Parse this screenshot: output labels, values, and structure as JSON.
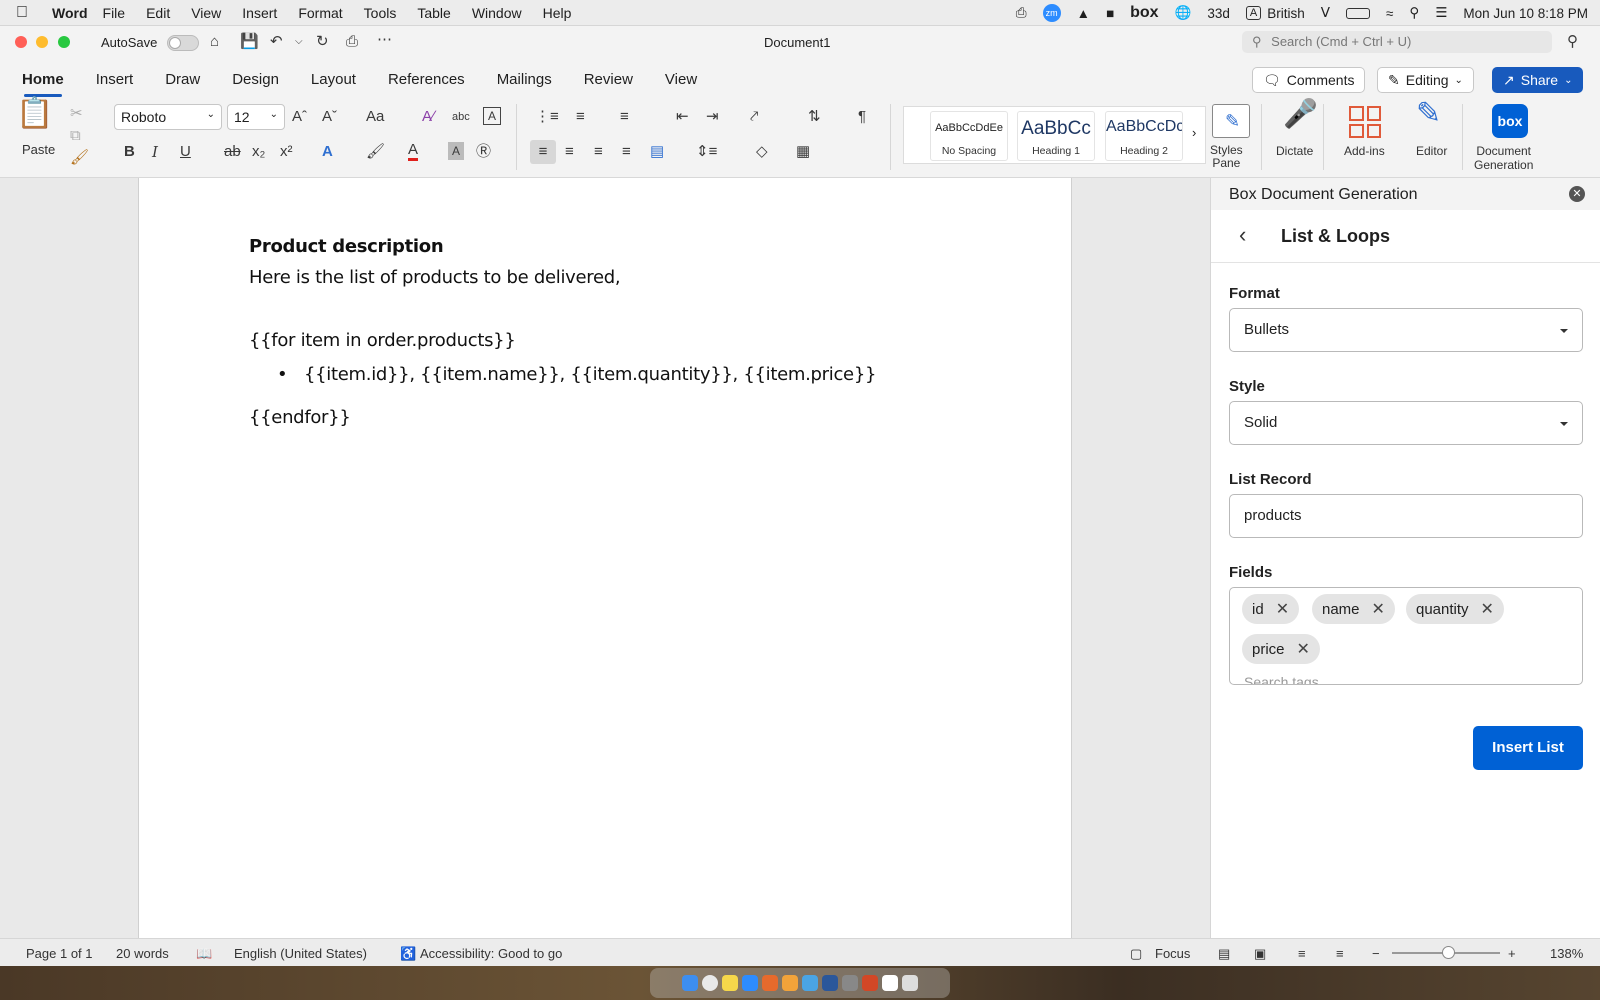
{
  "menubar": {
    "app": "Word",
    "items": [
      "File",
      "Edit",
      "View",
      "Insert",
      "Format",
      "Tools",
      "Table",
      "Window",
      "Help"
    ],
    "status": {
      "battery_text": "33d",
      "input_source": "British",
      "datetime": "Mon Jun 10  8:18 PM",
      "box_label": "box"
    }
  },
  "window": {
    "autosave_label": "AutoSave",
    "title": "Document1",
    "search_placeholder": "Search (Cmd + Ctrl + U)"
  },
  "tabs": [
    "Home",
    "Insert",
    "Draw",
    "Design",
    "Layout",
    "References",
    "Mailings",
    "Review",
    "View"
  ],
  "active_tab": "Home",
  "actions": {
    "comments": "Comments",
    "editing": "Editing",
    "share": "Share"
  },
  "ribbon": {
    "paste_label": "Paste",
    "font_name": "Roboto",
    "font_size": "12",
    "styles": [
      {
        "sample": "AaBbCcDdEe",
        "caption": "No Spacing"
      },
      {
        "sample": "AaBbCc",
        "caption": "Heading 1"
      },
      {
        "sample": "AaBbCcDc",
        "caption": "Heading 2"
      }
    ],
    "styles_pane": [
      "Styles",
      "Pane"
    ],
    "dictate": "Dictate",
    "addins": "Add-ins",
    "editor": "Editor",
    "docgen": [
      "Document",
      "Generation"
    ],
    "docgen_logo": "box"
  },
  "document": {
    "heading": "Product description",
    "intro": "Here is the list of products to be delivered,",
    "loop_start": "{{for item in order.products}}",
    "bullet": "{{item.id}}, {{item.name}}, {{item.quantity}}, {{item.price}}",
    "loop_end": "{{endfor}}"
  },
  "panel": {
    "title": "Box Document Generation",
    "section": "List & Loops",
    "format_label": "Format",
    "format_value": "Bullets",
    "style_label": "Style",
    "style_value": "Solid",
    "record_label": "List Record",
    "record_value": "products",
    "fields_label": "Fields",
    "fields": [
      "id",
      "name",
      "quantity",
      "price"
    ],
    "search_placeholder": "Search tags",
    "insert_button": "Insert List"
  },
  "statusbar": {
    "page": "Page 1 of 1",
    "words": "20 words",
    "language": "English (United States)",
    "accessibility": "Accessibility: Good to go",
    "focus": "Focus",
    "zoom": "138%"
  },
  "colors": {
    "accent": "#185abd",
    "box_blue": "#0061d5"
  }
}
